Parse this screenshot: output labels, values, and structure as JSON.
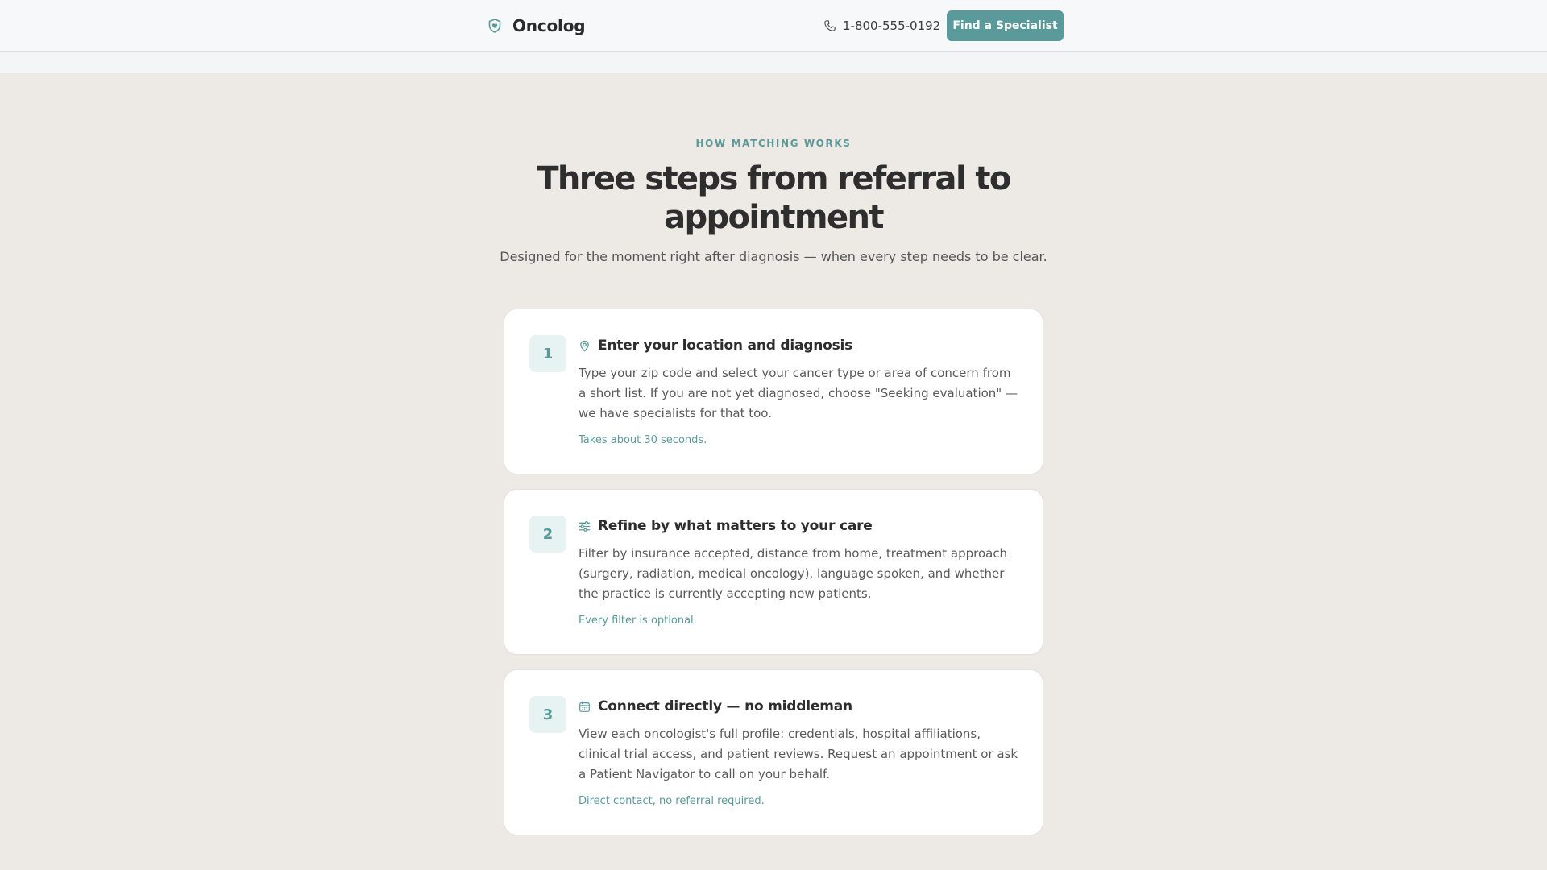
{
  "header": {
    "brand_name": "Oncolog",
    "brand_icon": "shield-heart-icon",
    "phone_icon": "phone-icon",
    "phone_number": "1-800-555-0192",
    "cta_label": "Find a Specialist"
  },
  "section": {
    "eyebrow": "HOW MATCHING WORKS",
    "title": "Three steps from referral to appointment",
    "subtitle": "Designed for the moment right after diagnosis — when every step needs to be clear."
  },
  "steps": [
    {
      "number": "1",
      "icon": "map-pin-icon",
      "title": "Enter your location and diagnosis",
      "description": "Type your zip code and select your cancer type or area of concern from a short list. If you are not yet diagnosed, choose \"Seeking evaluation\" — we have specialists for that too.",
      "note": "Takes about 30 seconds."
    },
    {
      "number": "2",
      "icon": "sliders-icon",
      "title": "Refine by what matters to your care",
      "description": "Filter by insurance accepted, distance from home, treatment approach (surgery, radiation, medical oncology), language spoken, and whether the practice is currently accepting new patients.",
      "note": "Every filter is optional."
    },
    {
      "number": "3",
      "icon": "calendar-icon",
      "title": "Connect directly — no middleman",
      "description": "View each oncologist's full profile: credentials, hospital affiliations, clinical trial access, and patient reviews. Request an appointment or ask a Patient Navigator to call on your behalf.",
      "note": "Direct contact, no referral required."
    }
  ],
  "colors": {
    "accent": "#5b9a9b",
    "page_background": "#ede9e4",
    "card_background": "#ffffff",
    "number_badge_background": "#e7f3f2"
  }
}
